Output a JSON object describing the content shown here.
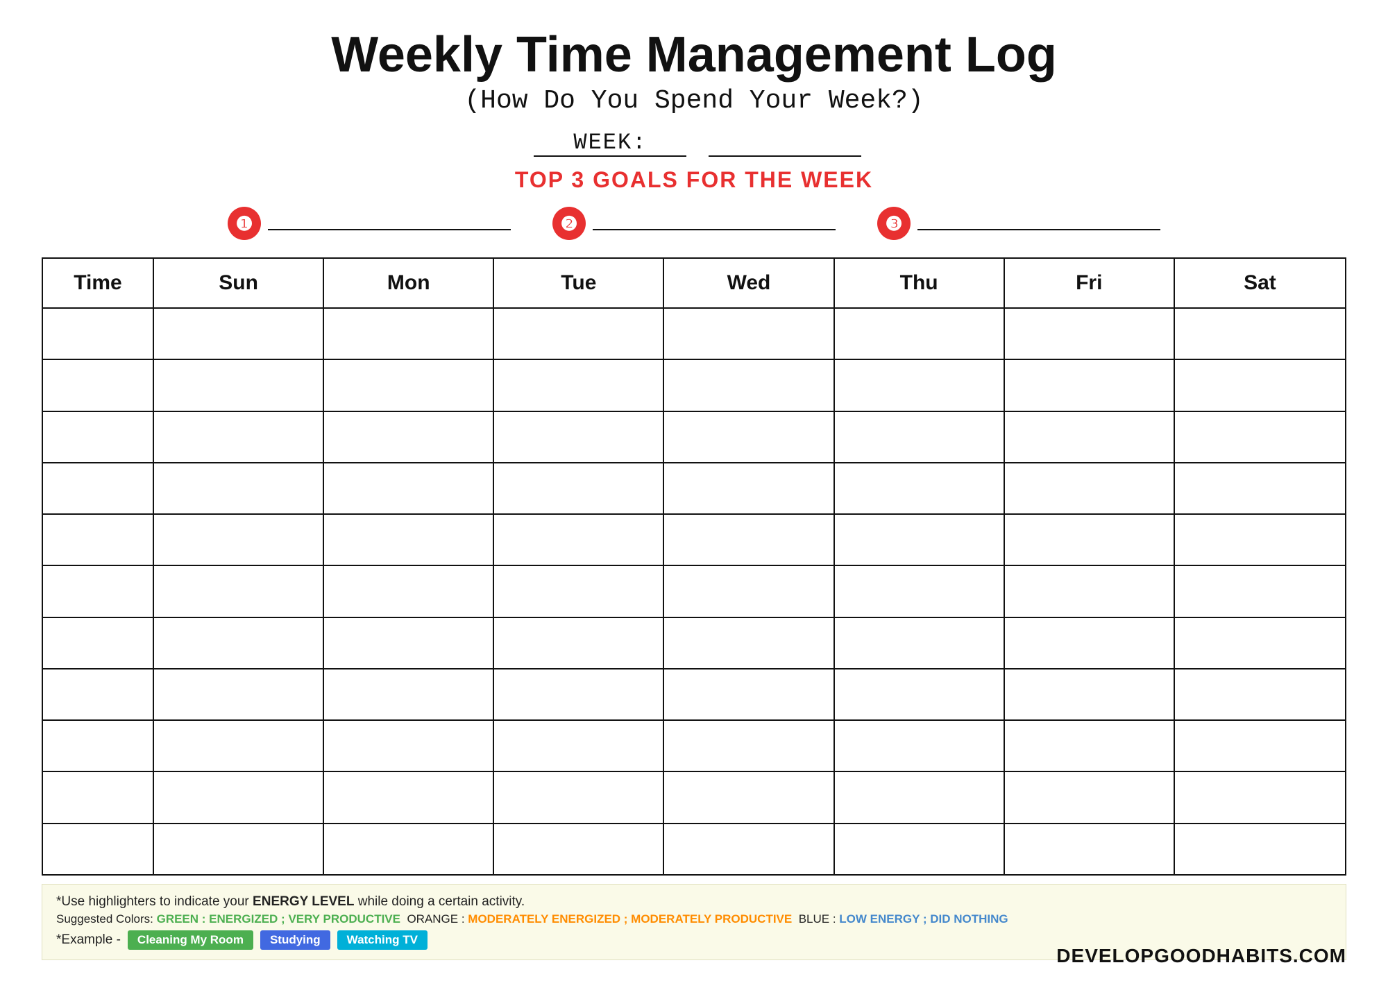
{
  "header": {
    "title": "Weekly Time Management Log",
    "subtitle": "(How Do You Spend Your Week?)",
    "week_label": "WEEK:",
    "goals_title": "TOP 3 GOALS FOR THE WEEK"
  },
  "goals": [
    {
      "number": "❶",
      "label": "goal-1"
    },
    {
      "number": "❷",
      "label": "goal-2"
    },
    {
      "number": "❸",
      "label": "goal-3"
    }
  ],
  "table": {
    "headers": [
      "Time",
      "Sun",
      "Mon",
      "Tue",
      "Wed",
      "Thu",
      "Fri",
      "Sat"
    ],
    "row_count": 11
  },
  "footer": {
    "line1_prefix": "*Use highlighters to indicate your ",
    "line1_highlight": "ENERGY LEVEL",
    "line1_suffix": " while doing a certain activity.",
    "line2_prefix": "Suggested Colors: ",
    "green_label": "GREEN : ENERGIZED ; VERY PRODUCTIVE",
    "orange_sep": " ORANGE : ",
    "orange_label": "MODERATELY ENERGIZED ; MODERATELY PRODUCTIVE",
    "blue_sep": " BLUE : ",
    "blue_label": "LOW ENERGY ; DID NOTHING",
    "example_prefix": "*Example -",
    "badge1": "Cleaning My Room",
    "badge2": "Studying",
    "badge3": "Watching TV"
  },
  "brand": "DEVELOPGOODHABITS.COM"
}
